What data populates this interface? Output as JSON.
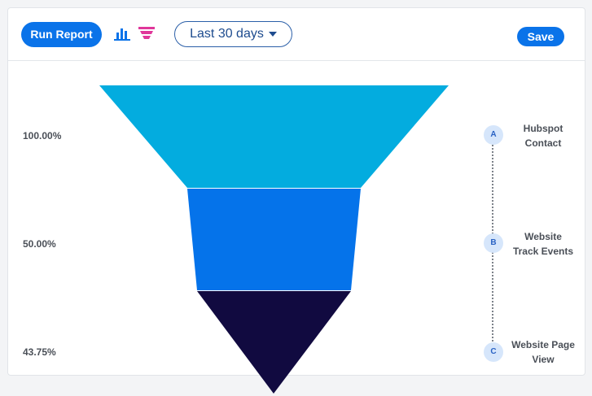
{
  "toolbar": {
    "run_report_label": "Run Report",
    "chart_icon": "bar-chart-icon",
    "funnel_icon": "funnel-icon",
    "date_range": "Last 30 days",
    "save_label": "Save"
  },
  "colors": {
    "primary": "#0a73e9",
    "funnel_step_a": "#03acdf",
    "funnel_step_b": "#0573ea",
    "funnel_step_c": "#110a40",
    "chart_icon_color": "#0a73e9",
    "funnel_icon_color": "#e0379a"
  },
  "funnel": {
    "percentages": [
      "100.00%",
      "50.00%",
      "43.75%"
    ],
    "steps": [
      {
        "marker": "A",
        "label_line1": "Hubspot",
        "label_line2": "Contact"
      },
      {
        "marker": "B",
        "label_line1": "Website",
        "label_line2": "Track Events"
      },
      {
        "marker": "C",
        "label_line1": "Website Page",
        "label_line2": "View"
      }
    ]
  }
}
